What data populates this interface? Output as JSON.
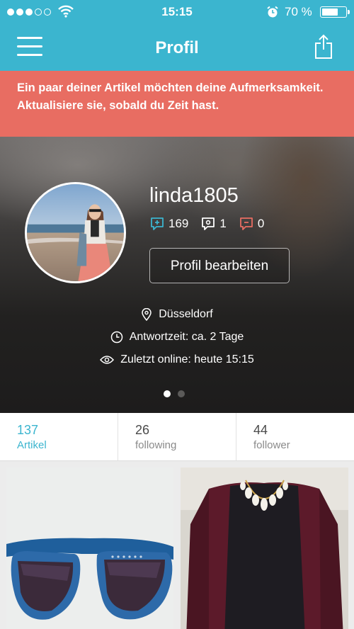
{
  "status_bar": {
    "time": "15:15",
    "battery_text": "70 %",
    "battery_level": 0.7,
    "icons": [
      "signal-dots-icon",
      "wifi-icon",
      "alarm-clock-icon",
      "battery-icon"
    ]
  },
  "nav": {
    "title": "Profil",
    "left_icon": "hamburger-menu-icon",
    "right_icon": "share-icon"
  },
  "banner": {
    "text": "Ein paar deiner Artikel möchten deine Aufmerksamkeit. Aktualisiere sie, sobald du Zeit hast.",
    "color": "#e86d62"
  },
  "profile": {
    "username": "linda1805",
    "ratings": {
      "positive": "169",
      "neutral": "1",
      "negative": "0"
    },
    "edit_label": "Profil bearbeiten",
    "location": "Düsseldorf",
    "response_time": "Antwortzeit: ca. 2 Tage",
    "last_online": "Zuletzt online: heute 15:15",
    "page_count": 2,
    "active_page": 1
  },
  "tabs": [
    {
      "count": "137",
      "label": "Artikel",
      "active": true
    },
    {
      "count": "26",
      "label": "following",
      "active": false
    },
    {
      "count": "44",
      "label": "follower",
      "active": false
    }
  ],
  "items": [
    {
      "icon": "sunglasses-photo"
    },
    {
      "icon": "burgundy-sweater-photo"
    }
  ],
  "colors": {
    "accent": "#3bb5cf",
    "positive": "#3bb5cf",
    "neutral": "#ffffff",
    "negative": "#e86d62"
  }
}
